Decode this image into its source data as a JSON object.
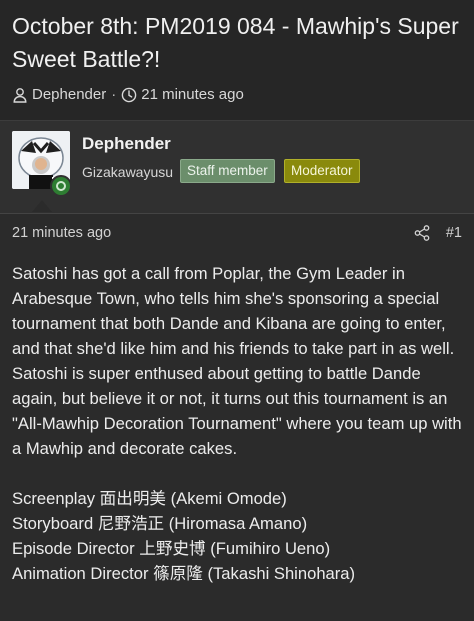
{
  "thread": {
    "breadcrumb_partial": "",
    "title": "October 8th: PM2019 084 - Mawhip's Super Sweet Battle?!",
    "author": "Dephender",
    "time": "21 minutes ago"
  },
  "user": {
    "name": "Dephender",
    "title": "Gizakawayusu",
    "badges": [
      "Staff member",
      "Moderator"
    ],
    "online": true
  },
  "post": {
    "time": "21 minutes ago",
    "number": "#1",
    "body": "Satoshi has got a call from Poplar, the Gym Leader in Arabesque Town, who tells him she's sponsoring a special tournament that both Dande and Kibana are going to enter, and that she'd like him and his friends to take part in as well. Satoshi is super enthused about getting to battle Dande again, but believe it or not, it turns out this tournament is an \"All-Mawhip Decoration Tournament\" where you team up with a Mawhip and decorate cakes.",
    "credits": [
      "Screenplay 面出明美 (Akemi Omode)",
      "Storyboard 尼野浩正 (Hiromasa Amano)",
      "Episode Director 上野史博 (Fumihiro Ueno)",
      "Animation Director 篠原隆 (Takashi Shinohara)"
    ]
  },
  "icons": {
    "author": "user-icon",
    "time": "clock-icon",
    "share": "share-icon",
    "online": "online-status-icon"
  },
  "colors": {
    "staff_badge": "#6b8e6b",
    "moderator_badge": "#8a8a0c",
    "online": "#2e7d32"
  }
}
